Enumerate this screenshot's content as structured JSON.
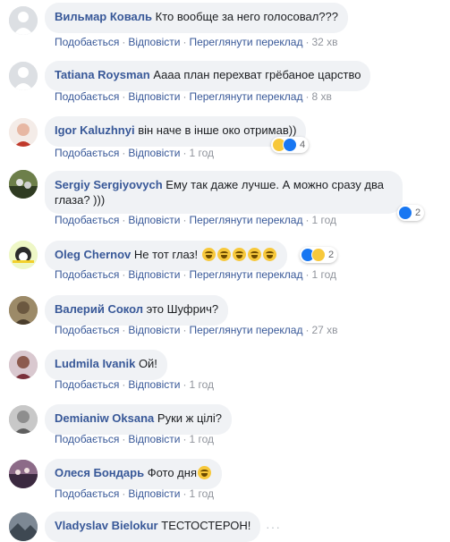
{
  "actions": {
    "like": "Подобається",
    "reply": "Відповісти",
    "translate": "Переглянути переклад",
    "sep": "·"
  },
  "comments": [
    {
      "author": "Вильмар Коваль",
      "text": "Кто вообще за него голосовал???",
      "time": "32 хв"
    },
    {
      "author": "Tatiana Roysman",
      "text": "Аааа план перехват грёбаное царство",
      "time": "8 хв"
    },
    {
      "author": "Igor Kaluzhnyi",
      "text": "він наче в інше око отримав))",
      "time": "1 год",
      "reactions": {
        "count": "4",
        "icons": [
          "haha",
          "like"
        ]
      }
    },
    {
      "author": "Sergiy Sergiyovych",
      "text": "Ему так даже лучше. А можно сразу два",
      "text2": "глаза? )))",
      "time": "1 год",
      "reactions": {
        "count": "2",
        "icons": [
          "like"
        ]
      }
    },
    {
      "author": "Oleg Chernov",
      "text": "Не тот глаз!",
      "emoji_count": 5,
      "time": "1 год",
      "reactions": {
        "count": "2",
        "icons": [
          "like",
          "haha"
        ]
      }
    },
    {
      "author": "Валерий Сокол",
      "text": "это Шуфрич?",
      "time": "27 хв"
    },
    {
      "author": "Ludmila Ivanik",
      "text": "Ой!",
      "time": "1 год"
    },
    {
      "author": "Demianiw Oksana",
      "text": "Руки ж цілі?",
      "time": "1 год"
    },
    {
      "author": "Олеся Бондарь",
      "text": "Фото дня",
      "emoji_count": 1,
      "time": "1 год"
    },
    {
      "author": "Vladyslav Bielokur",
      "text": "ТЕСТОСТЕРОН!",
      "more": "···"
    }
  ]
}
